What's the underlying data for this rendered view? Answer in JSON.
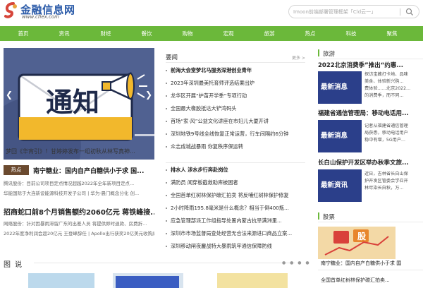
{
  "site": {
    "logo_text": "金融信息网",
    "logo_url": "www.cfiex.com"
  },
  "search": {
    "placeholder": "Imoon前端部署管理框架「Cld云一」",
    "icon": "search-icon"
  },
  "nav": {
    "items": [
      "首页",
      "资讯",
      "财经",
      "餐饮",
      "购物",
      "宏观",
      "旅游",
      "热点",
      "科技",
      "聚焦"
    ]
  },
  "banner": {
    "heading": "通知",
    "caption": "梦回《华宵引》！甘婷婷发布一组初秋从林写真神..."
  },
  "hot": {
    "badge": "热点",
    "title": "南宁糖业：国内自产白糖供小于求 国...",
    "lines": [
      "腾讯股份：目前公司项目定点情况超越2022年全年新项目定点...",
      "华能国际于大连新设能源科技开发子公司 | 华为·晨门概念分化 创..."
    ]
  },
  "feature": {
    "title": "招商蛇口前8个月销售额约2060亿元 蒋铁峰接...",
    "lines": [
      "网络股份：针对因暴雨滞留广东的出差人员 将提供即时退款、房费折...",
      "2022年度净利润会超20亿元 王登峰辞任 | Apollo出行获奖20亿美元收购威马..."
    ]
  },
  "tushuo": {
    "label": "图说"
  },
  "middle": {
    "head": "要闻",
    "more": "更多 >",
    "group1": [
      "前海大会堂梦北马服务深港创业青年",
      "2023年深圳最美托育师评选结果出炉",
      "龙华区开展“护苗开学季”专项行动",
      "全国最大橡胶抵达大铲湾码头",
      "首场“家·风”公益文化讲座在市妇儿大厦开讲",
      "深圳地铁9号线全线恢复正常运营，行车间隔约6分钟",
      "众志成城战暴雨 你复秩序保运转"
    ],
    "group2": [
      "排水人 涉水步行奔赴岗位",
      "满防员 闻穿板截救助库被困者",
      "全国首单红树林保护碳汇拍卖 将反哺红树林保护修复",
      "2小时降雨195.8毫米是什么概念？相当于倒400瓶...",
      "应急管理部派工作组指导处置内蒙古抗旱满洲里...",
      "深圳市市场监督局查处经营无合法来源进口商品立案...",
      "深圳移动闸夜鏖战特大暴雨筑牢通信保障防线"
    ]
  },
  "right": {
    "travel_head": "旅游",
    "travel": [
      {
        "title": "2022北京消费季”推出“约惠...",
        "img_text": "最新消息",
        "desc": [
          "探访宝藏打卡地、品味",
          "美食、体验新兴购…",
          "费体验……北京2022…",
          "的消费季，而不同…"
        ]
      },
      {
        "title": "福建省通信管理局：移动电话用...",
        "img_text": "最新消息",
        "desc": [
          "记者从福建省通信管理",
          "局获悉，移动电话用户",
          "稳中有增，5G用户..."
        ]
      },
      {
        "title": "长白山保护开发区举办秋季文旅...",
        "img_text": "最新资讯",
        "desc": [
          "近日，吉林省长白山保",
          "护开发区管委会学召开",
          "林尽染长白秋，万..."
        ]
      }
    ],
    "stock_head": "股票",
    "stock_img_text": "股",
    "stock_caption": "南宁糖业：国内自产白糖供小于求 国",
    "stock_next": "全国首单红树林保护碳汇拍卖..."
  },
  "colors": {
    "nav_bg": "#6bb83a",
    "accent": "#6bb83a",
    "hot_badge": "#6b4a2f"
  }
}
